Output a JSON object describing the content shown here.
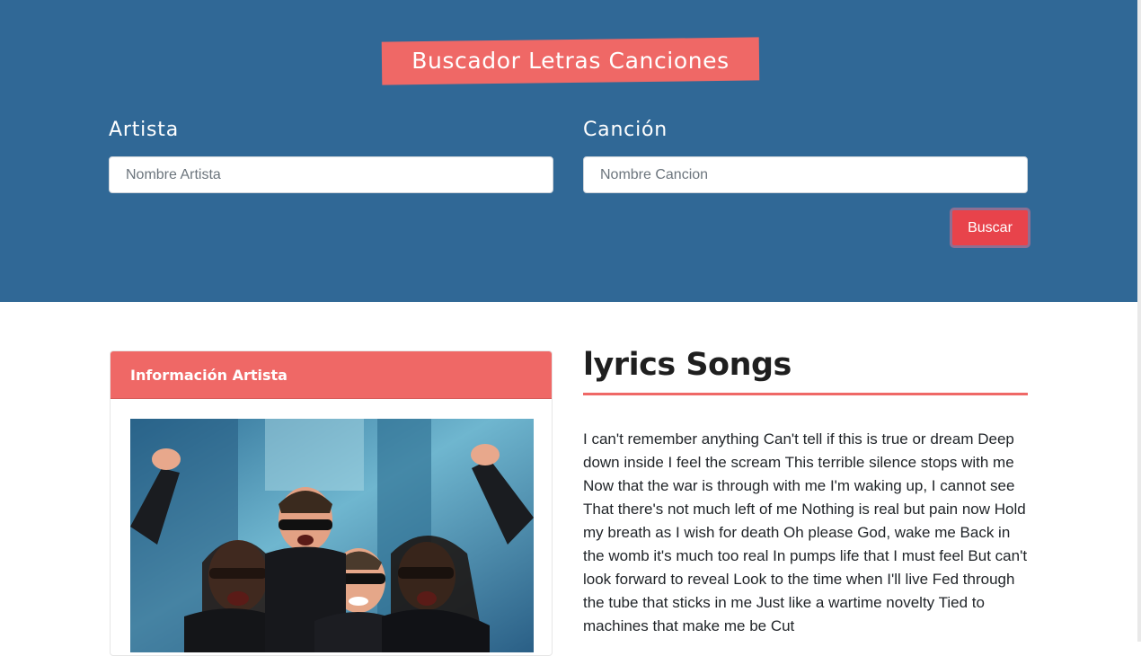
{
  "header": {
    "title": "Buscador Letras Canciones",
    "colors": {
      "background": "#306896",
      "accent": "#ef6866",
      "button": "#e8434b"
    }
  },
  "form": {
    "artist_label": "Artista",
    "artist_placeholder": "Nombre Artista",
    "artist_value": "",
    "song_label": "Canción",
    "song_placeholder": "Nombre Cancion",
    "song_value": "",
    "search_button": "Buscar"
  },
  "artist_card": {
    "heading": "Información Artista",
    "photo_icon": "band-photo"
  },
  "lyrics": {
    "heading": "lyrics Songs",
    "text": "I can't remember anything Can't tell if this is true or dream Deep down inside I feel the scream This terrible silence stops with me Now that the war is through with me I'm waking up, I cannot see That there's not much left of me Nothing is real but pain now Hold my breath as I wish for death Oh please God, wake me Back in the womb it's much too real In pumps life that I must feel But can't look forward to reveal Look to the time when I'll live Fed through the tube that sticks in me Just like a wartime novelty Tied to machines that make me be Cut"
  }
}
